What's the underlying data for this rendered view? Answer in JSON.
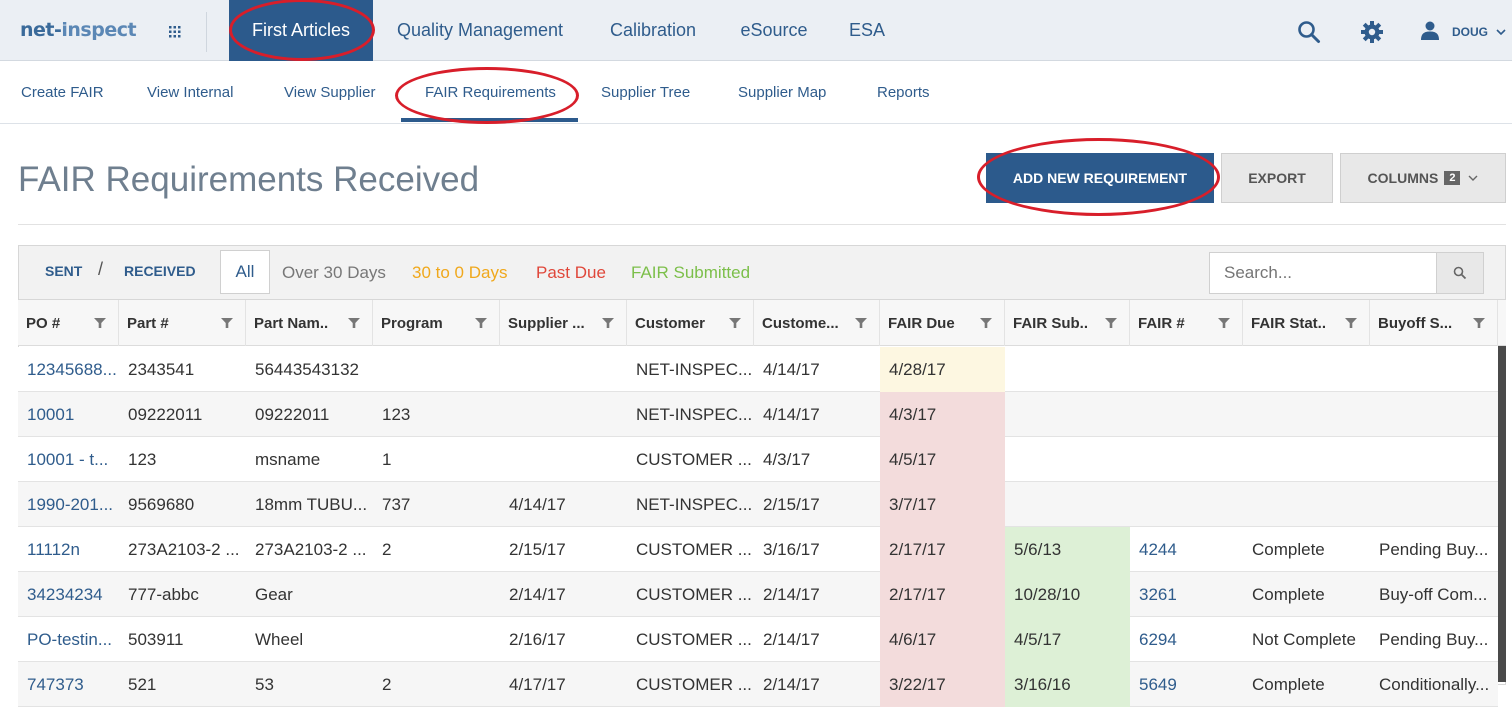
{
  "brand": {
    "logo_left": "net-",
    "logo_right": "inspect"
  },
  "top_nav": {
    "items": [
      {
        "label": "First Articles",
        "active": true
      },
      {
        "label": "Quality Management"
      },
      {
        "label": "Calibration"
      },
      {
        "label": "eSource"
      },
      {
        "label": "ESA"
      }
    ],
    "icons": [
      "apps-grid-icon",
      "search-icon",
      "gear-icon",
      "user-icon",
      "chevron-down-icon"
    ],
    "user": "DOUG"
  },
  "sub_nav": {
    "items": [
      {
        "label": "Create FAIR"
      },
      {
        "label": "View Internal"
      },
      {
        "label": "View Supplier"
      },
      {
        "label": "FAIR Requirements",
        "active": true
      },
      {
        "label": "Supplier Tree"
      },
      {
        "label": "Supplier Map"
      },
      {
        "label": "Reports"
      }
    ]
  },
  "page": {
    "title": "FAIR Requirements Received"
  },
  "actions": {
    "add_new": "ADD NEW REQUIREMENT",
    "export": "EXPORT",
    "columns": "COLUMNS",
    "columns_count": "2"
  },
  "filters": {
    "sent": "SENT",
    "separator": "/",
    "received": "RECEIVED",
    "all": "All",
    "over30": "Over 30 Days",
    "within30": "30 to 0 Days",
    "past_due": "Past Due",
    "submitted": "FAIR Submitted",
    "search_placeholder": "Search..."
  },
  "colors": {
    "brand_blue": "#2c5a8c",
    "warning_text": "#f0a81c",
    "danger_text": "#e0473a",
    "success_text": "#7cbf4a",
    "due_soon_bg": "#fdf7e1",
    "past_due_bg": "#f3dcdc",
    "submitted_bg": "#ddf0d6",
    "annotation_red": "#d81e2a"
  },
  "table": {
    "columns": [
      "PO #",
      "Part #",
      "Part Nam..",
      "Program",
      "Supplier ...",
      "Customer",
      "Custome...",
      "FAIR Due",
      "FAIR Sub..",
      "FAIR #",
      "FAIR Stat..",
      "Buyoff S..."
    ],
    "rows": [
      {
        "cells": [
          "12345688...",
          "2343541",
          "56443543132",
          "",
          "",
          "NET-INSPEC...",
          "4/14/17",
          "4/28/17",
          "",
          "",
          "",
          ""
        ],
        "due_status": "soon",
        "submitted": false
      },
      {
        "cells": [
          "10001",
          "09222011",
          "09222011",
          "123",
          "",
          "NET-INSPEC...",
          "4/14/17",
          "4/3/17",
          "",
          "",
          "",
          ""
        ],
        "due_status": "past",
        "submitted": false
      },
      {
        "cells": [
          "10001 - t...",
          "123",
          "msname",
          "1",
          "",
          "CUSTOMER ...",
          "4/3/17",
          "4/5/17",
          "",
          "",
          "",
          ""
        ],
        "due_status": "past",
        "submitted": false
      },
      {
        "cells": [
          "1990-201...",
          "9569680",
          "18mm TUBU...",
          "737",
          "4/14/17",
          "NET-INSPEC...",
          "2/15/17",
          "3/7/17",
          "",
          "",
          "",
          ""
        ],
        "due_status": "past",
        "submitted": false
      },
      {
        "cells": [
          "11112n",
          "273A2103-2 ...",
          "273A2103-2 ...",
          "2",
          "2/15/17",
          "CUSTOMER ...",
          "3/16/17",
          "2/17/17",
          "5/6/13",
          "4244",
          "Complete",
          "Pending Buy..."
        ],
        "due_status": "past",
        "submitted": true
      },
      {
        "cells": [
          "34234234",
          "777-abbc",
          "Gear",
          "",
          "2/14/17",
          "CUSTOMER ...",
          "2/14/17",
          "2/17/17",
          "10/28/10",
          "3261",
          "Complete",
          "Buy-off Com..."
        ],
        "due_status": "past",
        "submitted": true
      },
      {
        "cells": [
          "PO-testin...",
          "503911",
          "Wheel",
          "",
          "2/16/17",
          "CUSTOMER ...",
          "2/14/17",
          "4/6/17",
          "4/5/17",
          "6294",
          "Not Complete",
          "Pending Buy..."
        ],
        "due_status": "past",
        "submitted": true
      },
      {
        "cells": [
          "747373",
          "521",
          "53",
          "2",
          "4/17/17",
          "CUSTOMER ...",
          "2/14/17",
          "3/22/17",
          "3/16/16",
          "5649",
          "Complete",
          "Conditionally..."
        ],
        "due_status": "past",
        "submitted": true
      }
    ]
  }
}
